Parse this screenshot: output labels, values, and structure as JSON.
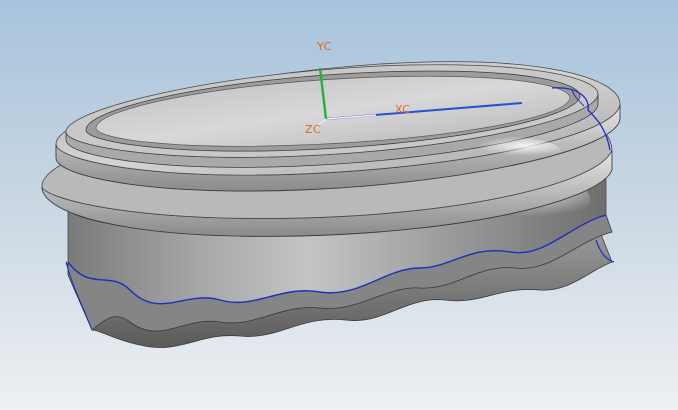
{
  "viewport": {
    "background_top": "#a7c3dc",
    "background_bottom": "#eef1f3"
  },
  "csys": {
    "x_label": "XC",
    "y_label": "YC",
    "z_label": "ZC",
    "x_axis_color": "#2a4fd8",
    "y_axis_color": "#1fb43a",
    "label_color": "#d96a1f"
  },
  "model": {
    "body_color": "#9a9a9a",
    "edge_highlight_color": "#1f2fbf"
  }
}
